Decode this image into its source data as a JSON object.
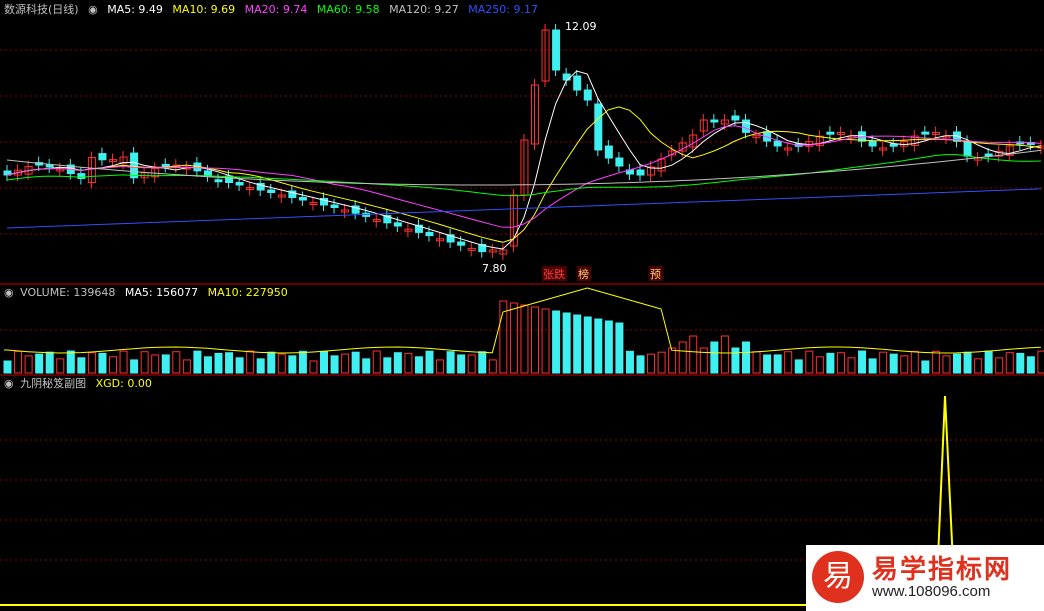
{
  "price_header": {
    "title": "数源科技(日线)",
    "items": [
      {
        "label": "MA5: 9.49",
        "color": "#ffffff"
      },
      {
        "label": "MA10: 9.69",
        "color": "#ffff00"
      },
      {
        "label": "MA20: 9.74",
        "color": "#ff40ff"
      },
      {
        "label": "MA60: 9.58",
        "color": "#00ff00"
      },
      {
        "label": "MA120: 9.27",
        "color": "#c0c0c0"
      },
      {
        "label": "MA250: 9.17",
        "color": "#3050ff"
      }
    ]
  },
  "volume_header": {
    "items": [
      {
        "label": "VOLUME: 139648",
        "color": "#c0c0c0"
      },
      {
        "label": "MA5: 156077",
        "color": "#ffffff"
      },
      {
        "label": "MA10: 227950",
        "color": "#ffff00"
      }
    ]
  },
  "indicator_header": {
    "items": [
      {
        "label": "九阴秘笈副图",
        "color": "#c0c0c0"
      },
      {
        "label": "XGD: 0.00",
        "color": "#ffff00"
      }
    ]
  },
  "price_labels": {
    "high": "12.09",
    "low": "7.80"
  },
  "event_markers": [
    {
      "text": "张跌",
      "color": "#ff4040"
    },
    {
      "text": "榜",
      "color": "#ffd070"
    },
    {
      "text": "预",
      "color": "#ffd070"
    }
  ],
  "watermark": {
    "name": "易学指标网",
    "url": "www.108096.com",
    "mark": "易"
  },
  "colors": {
    "up": "#ff3030",
    "down": "#40f0f0",
    "grid": "#8b0000",
    "bg": "#000000"
  }
}
